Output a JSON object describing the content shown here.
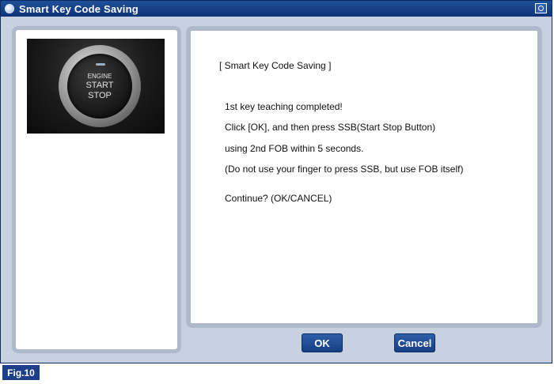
{
  "window": {
    "title": "Smart Key Code Saving"
  },
  "message": {
    "heading": "[ Smart Key Code Saving ]",
    "lines": [
      "1st key teaching completed!",
      "Click [OK], and then press SSB(Start Stop Button)",
      "using 2nd FOB within 5 seconds.",
      "(Do not use your finger to press SSB, but use FOB itself)",
      "Continue? (OK/CANCEL)"
    ]
  },
  "image": {
    "button_text": [
      "ENGINE",
      "START",
      "STOP"
    ]
  },
  "buttons": {
    "ok_label": "OK",
    "cancel_label": "Cancel"
  },
  "figure_label": "Fig.10",
  "colors": {
    "titlebar": "#1f4f9a",
    "button": "#1f4f9a",
    "panel_border": "#aeb9cb",
    "window_bg": "#c8d1df"
  }
}
